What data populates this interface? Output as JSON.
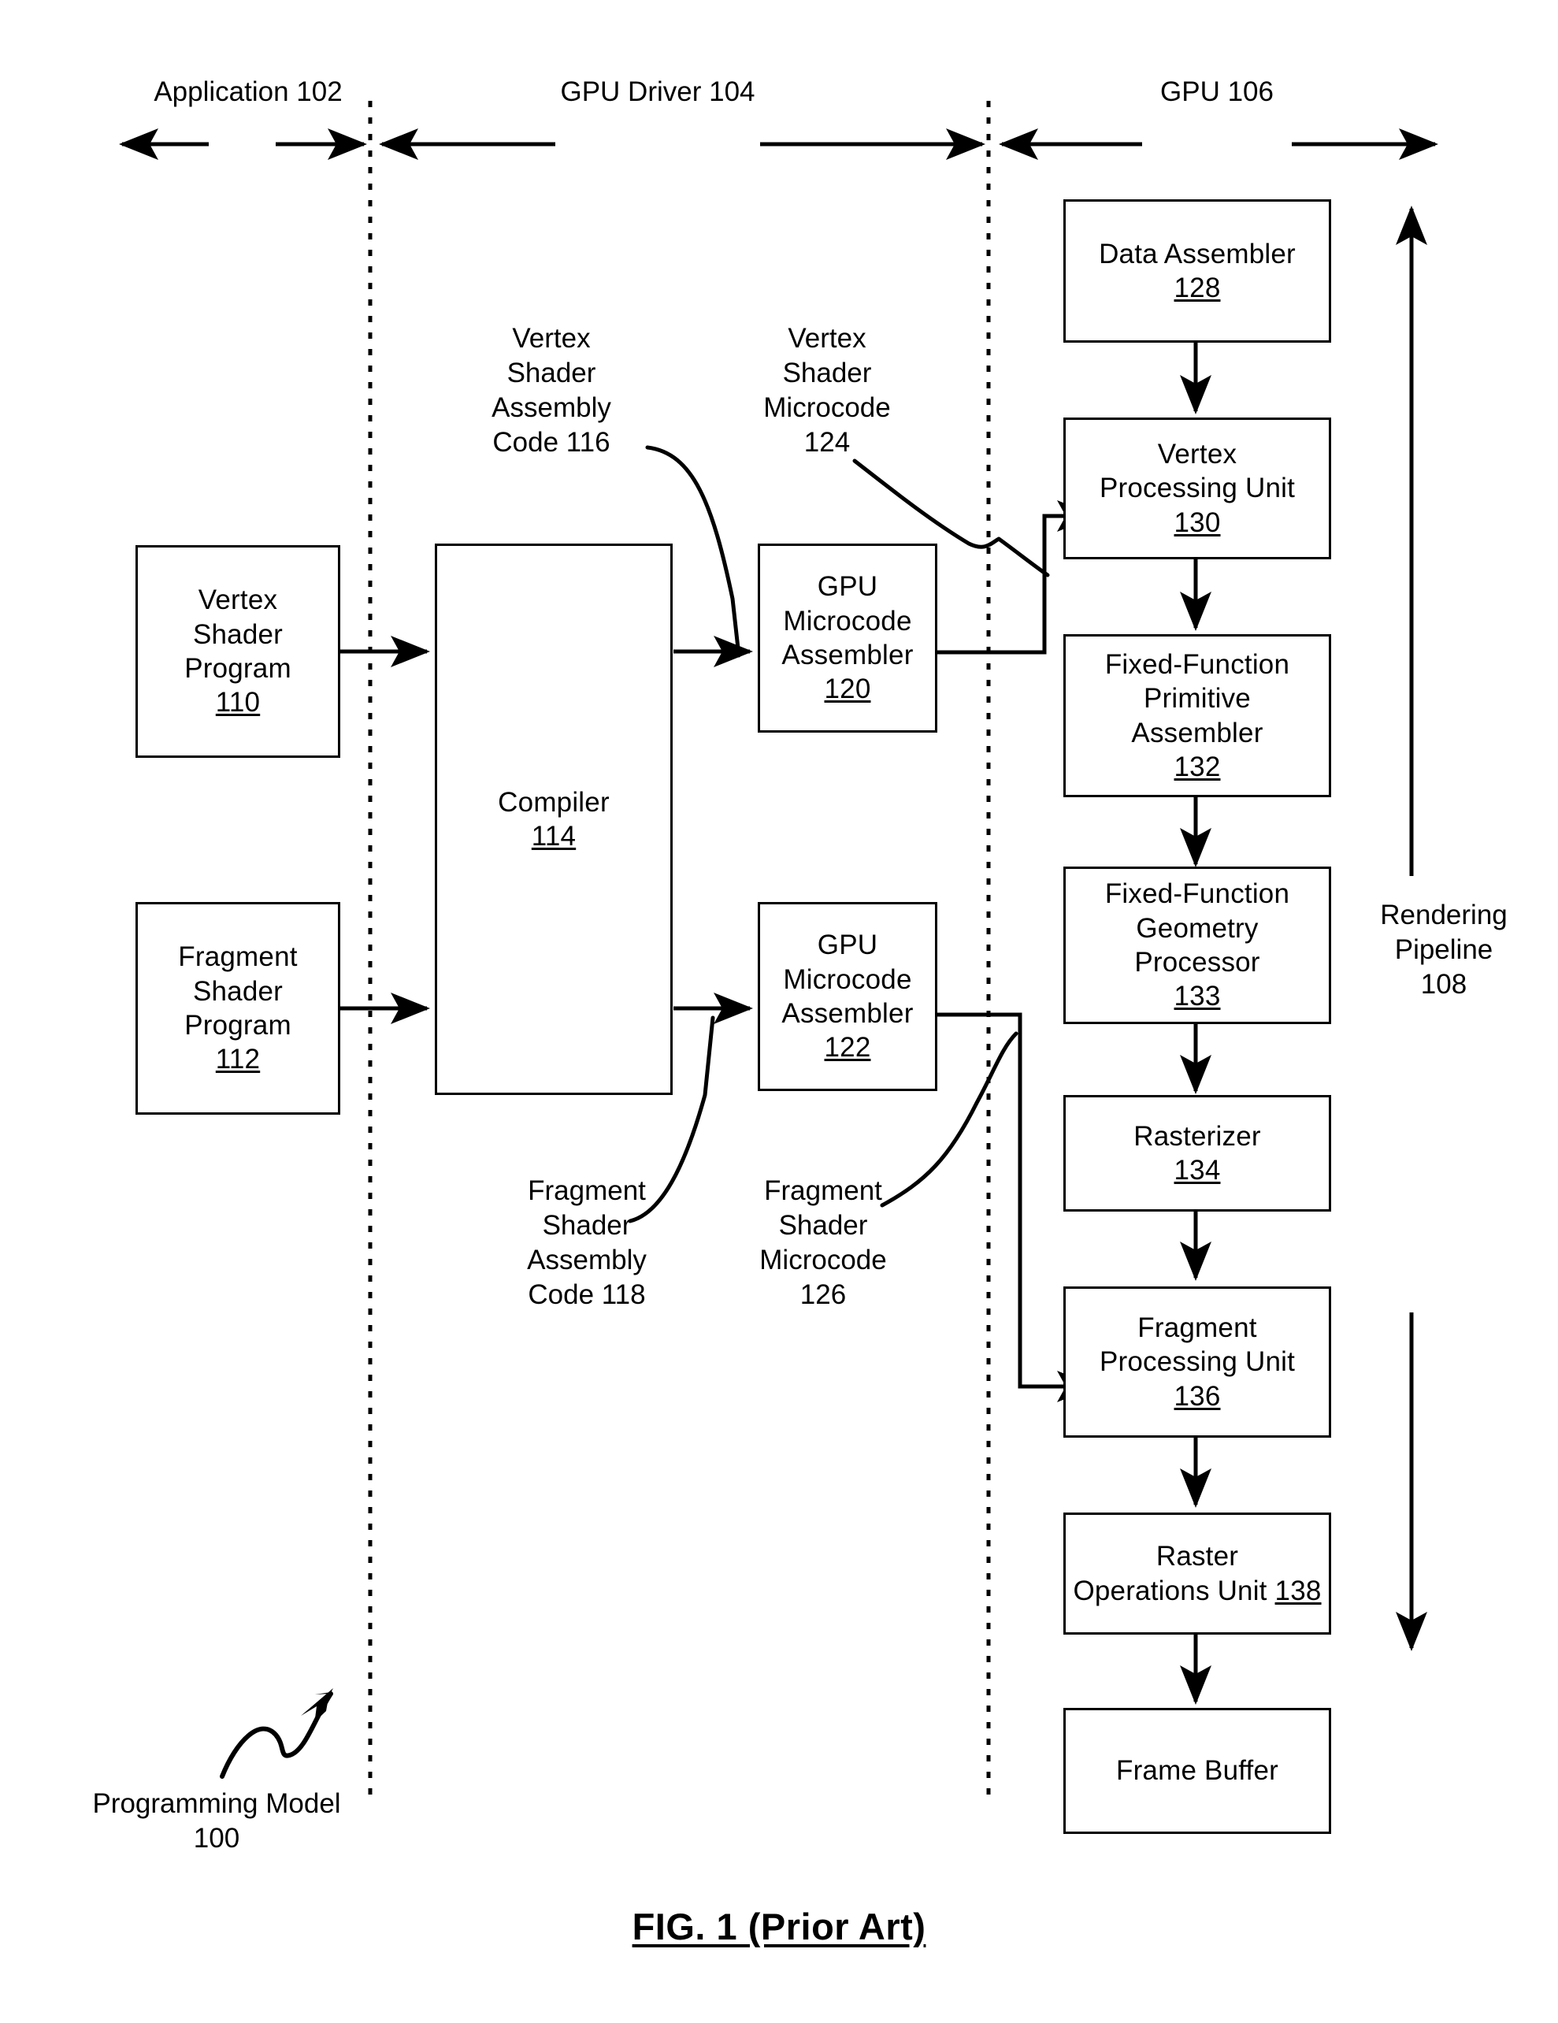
{
  "figure": {
    "caption": "FIG. 1 (Prior Art)",
    "overall_label_line1": "Programming Model",
    "overall_label_line2": "100"
  },
  "sections": [
    {
      "id": "application",
      "title": "Application",
      "number": "102"
    },
    {
      "id": "gpu-driver",
      "title": "GPU Driver",
      "number": "104"
    },
    {
      "id": "gpu",
      "title": "GPU",
      "number": "106"
    }
  ],
  "boxes": {
    "vertex_shader_program": {
      "l1": "Vertex",
      "l2": "Shader",
      "l3": "Program",
      "num": "110"
    },
    "fragment_shader_program": {
      "l1": "Fragment",
      "l2": "Shader",
      "l3": "Program",
      "num": "112"
    },
    "compiler": {
      "l1": "Compiler",
      "num": "114"
    },
    "gpu_microcode_assembler_vertex": {
      "l1": "GPU",
      "l2": "Microcode",
      "l3": "Assembler",
      "num": "120"
    },
    "gpu_microcode_assembler_fragment": {
      "l1": "GPU",
      "l2": "Microcode",
      "l3": "Assembler",
      "num": "122"
    },
    "data_assembler": {
      "l1": "Data Assembler",
      "num": "128"
    },
    "vertex_processing_unit": {
      "l1": "Vertex",
      "l2": "Processing Unit",
      "num": "130"
    },
    "fixed_function_primitive_assembler": {
      "l1": "Fixed-Function",
      "l2": "Primitive",
      "l3": "Assembler",
      "num": "132"
    },
    "fixed_function_geometry_processor": {
      "l1": "Fixed-Function",
      "l2": "Geometry",
      "l3": "Processor",
      "num": "133"
    },
    "rasterizer": {
      "l1": "Rasterizer",
      "num": "134"
    },
    "fragment_processing_unit": {
      "l1": "Fragment",
      "l2": "Processing Unit",
      "num": "136"
    },
    "raster_operations_unit": {
      "l1": "Raster",
      "l2_pre": "Operations Unit ",
      "l2_num": "138"
    },
    "frame_buffer": {
      "l1": "Frame Buffer"
    }
  },
  "annotations": {
    "vertex_shader_assembly_code": {
      "l1": "Vertex",
      "l2": "Shader",
      "l3": "Assembly",
      "l4": "Code 116"
    },
    "vertex_shader_microcode": {
      "l1": "Vertex",
      "l2": "Shader",
      "l3": "Microcode",
      "l4": "124"
    },
    "fragment_shader_assembly_code": {
      "l1": "Fragment",
      "l2": "Shader",
      "l3": "Assembly",
      "l4": "Code 118"
    },
    "fragment_shader_microcode": {
      "l1": "Fragment",
      "l2": "Shader",
      "l3": "Microcode",
      "l4": "126"
    },
    "rendering_pipeline": {
      "l1": "Rendering",
      "l2": "Pipeline",
      "l3": "108"
    }
  },
  "colors": {
    "ink": "#000000",
    "paper": "#ffffff"
  }
}
